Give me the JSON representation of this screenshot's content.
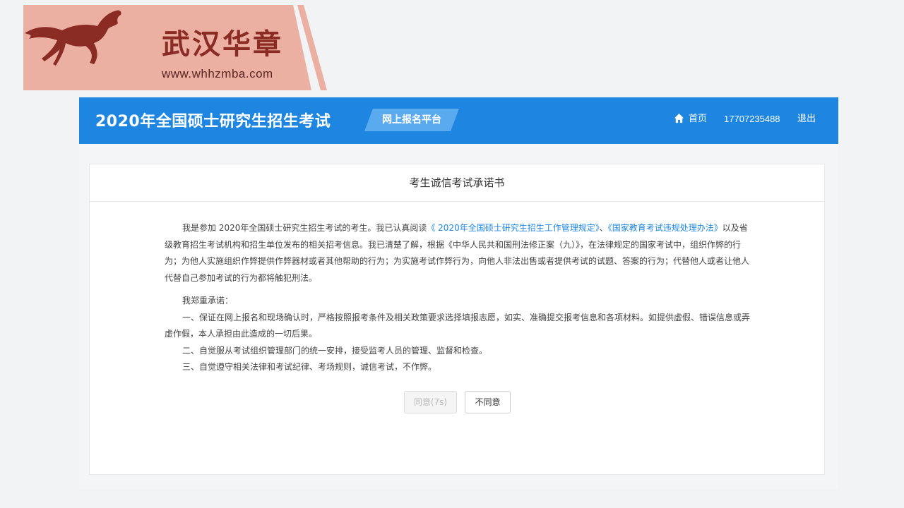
{
  "watermark": {
    "brand": "武汉华章",
    "url": "www.whhzmba.com"
  },
  "header": {
    "site_title": "2020年全国硕士研究生招生考试",
    "platform_badge": "网上报名平台",
    "nav_home": "首页",
    "nav_phone": "17707235488",
    "nav_logout": "退出",
    "bg_color": "#1e86e0"
  },
  "pledge": {
    "title": "考生诚信考试承诺书",
    "p1_a": "我是参加 2020年全国硕士研究生招生考试的考生。我已认真阅读",
    "p1_link1": "《 2020年全国硕士研究生招生工作管理规定》",
    "p1_sep": "、",
    "p1_link2": "《国家教育考试违规处理办法》",
    "p1_b": "以及省级教育招生考试机构和招生单位发布的相关招考信息。我已清楚了解，根据《中华人民共和国刑法修正案（九）》，在法律规定的国家考试中，组织作弊的行为；为他人实施组织作弊提供作弊器材或者其他帮助的行为；为实施考试作弊行为，向他人非法出售或者提供考试的试题、答案的行为；代替他人或者让他人代替自己参加考试的行为都将触犯刑法。",
    "p2": "我郑重承诺：",
    "p3": "一、保证在网上报名和现场确认时，严格按照报考条件及相关政策要求选择填报志愿，如实、准确提交报考信息和各项材料。如提供虚假、错误信息或弄虚作假，本人承担由此造成的一切后果。",
    "p4": "二、自觉服从考试组织管理部门的统一安排，接受监考人员的管理、监督和检查。",
    "p5": "三、自觉遵守相关法律和考试纪律、考场规则，诚信考试，不作弊。"
  },
  "buttons": {
    "agree": "同意(7s)",
    "disagree": "不同意"
  }
}
